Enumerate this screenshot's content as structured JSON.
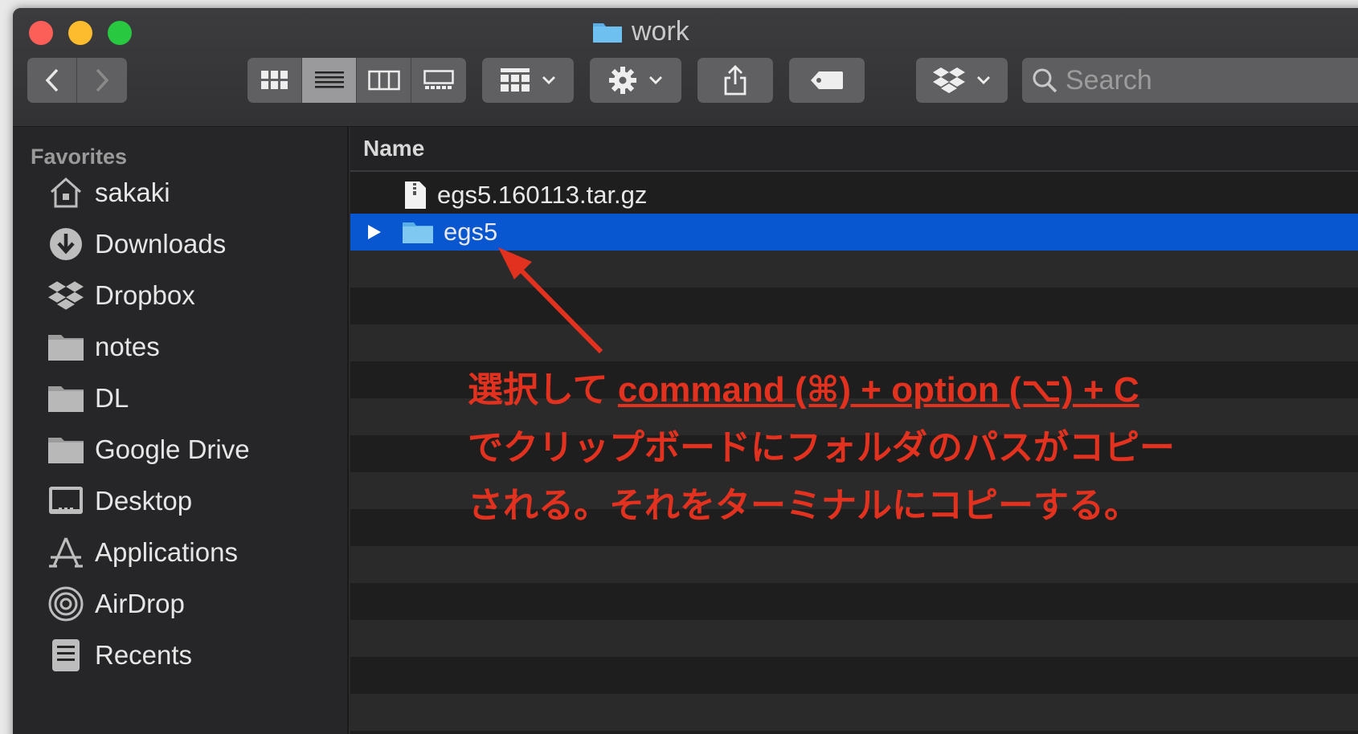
{
  "window": {
    "title": "work",
    "traffic_lights": {
      "close": "#fc5f57",
      "minimize": "#fdbc2e",
      "zoom": "#28c840"
    }
  },
  "toolbar": {
    "back_icon": "chevron-left-icon",
    "forward_icon": "chevron-right-icon",
    "view_modes": [
      "icon-view-icon",
      "list-view-icon",
      "column-view-icon",
      "gallery-view-icon"
    ],
    "active_view": "list-view-icon",
    "search": {
      "placeholder": "Search"
    }
  },
  "sidebar": {
    "heading": "Favorites",
    "items": [
      {
        "label": "sakaki",
        "icon": "home-icon"
      },
      {
        "label": "Downloads",
        "icon": "download-icon"
      },
      {
        "label": "Dropbox",
        "icon": "dropbox-icon"
      },
      {
        "label": "notes",
        "icon": "folder-icon"
      },
      {
        "label": "DL",
        "icon": "folder-icon"
      },
      {
        "label": "Google Drive",
        "icon": "folder-icon"
      },
      {
        "label": "Desktop",
        "icon": "desktop-icon"
      },
      {
        "label": "Applications",
        "icon": "applications-icon"
      },
      {
        "label": "AirDrop",
        "icon": "airdrop-icon"
      },
      {
        "label": "Recents",
        "icon": "recents-icon"
      }
    ]
  },
  "main": {
    "column_header": "Name",
    "rows": [
      {
        "name": "egs5.160113.tar.gz",
        "icon": "archive-file-icon",
        "selected": false
      },
      {
        "name": "egs5",
        "icon": "folder-icon",
        "selected": true
      }
    ]
  },
  "annotation": {
    "prefix": "選択して ",
    "shortcut": "command (⌘) + option (⌥) + C",
    "line2": "でクリップボードにフォルダのパスがコピー",
    "line3": "される。それをターミナルにコピーする。",
    "color": "#e2321f"
  }
}
